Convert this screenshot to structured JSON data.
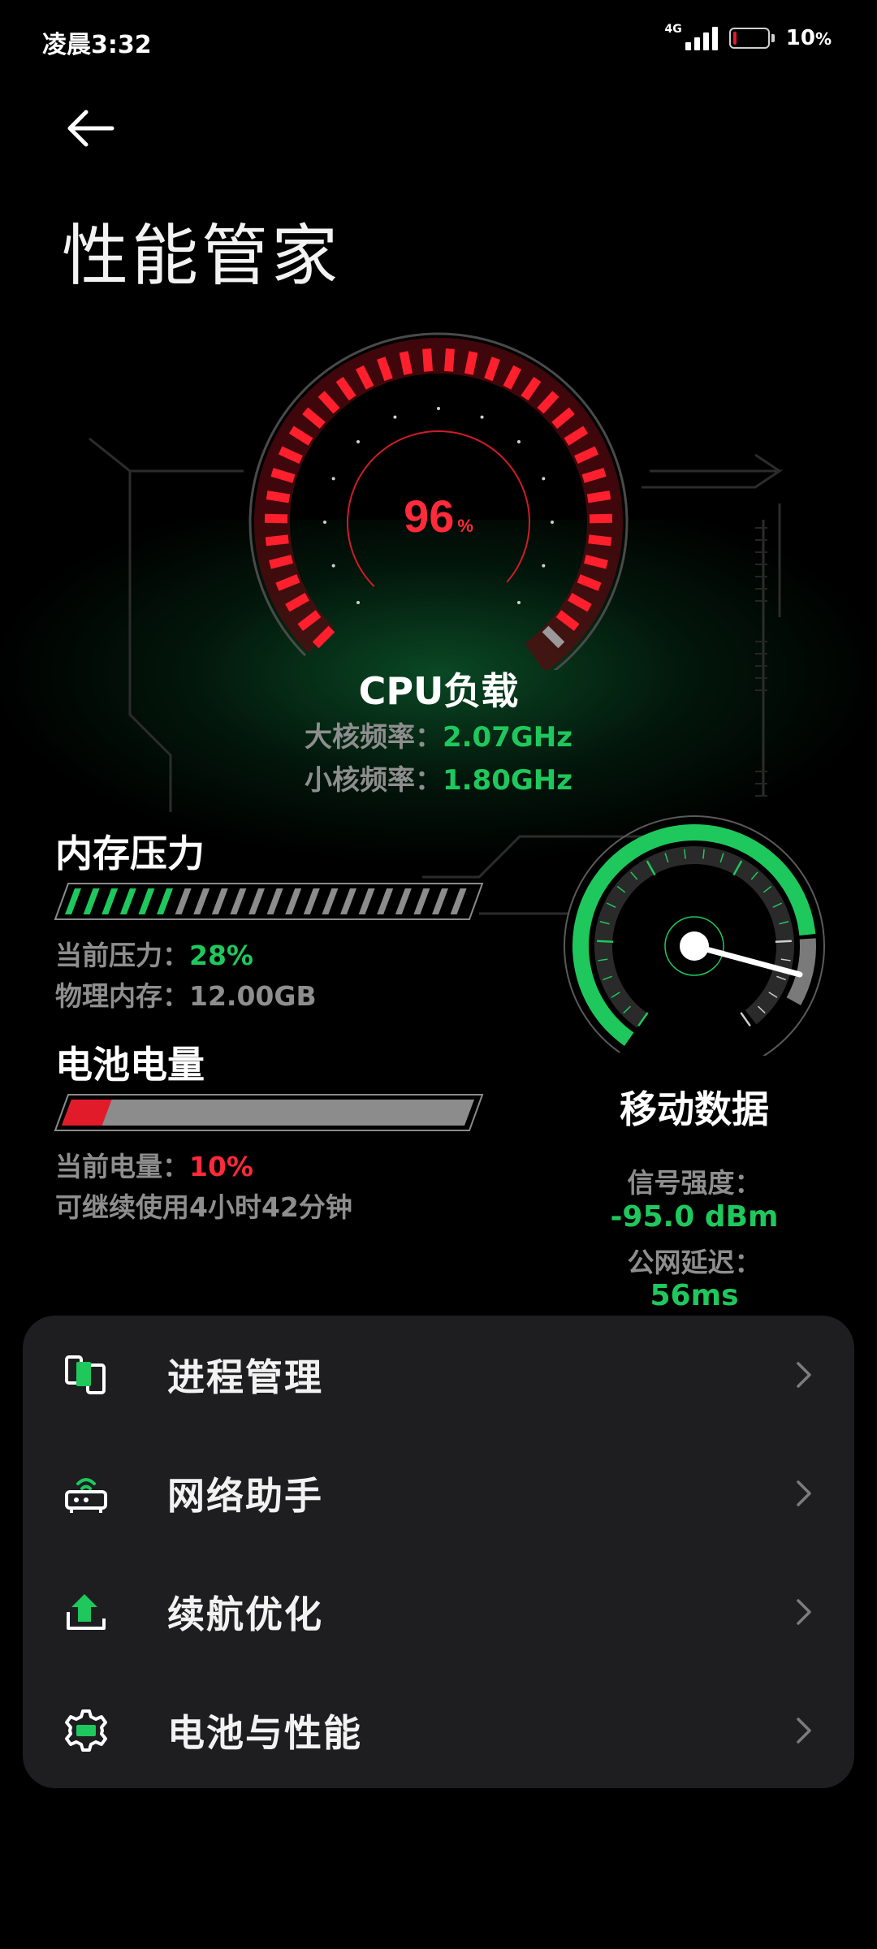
{
  "status_bar": {
    "time": "凌晨3:32",
    "network": "4G",
    "battery_percent": "10",
    "battery_unit": "%"
  },
  "header": {
    "back_icon": "arrow-left-icon",
    "title": "性能管家"
  },
  "cpu": {
    "load_value": "96",
    "load_unit": "%",
    "load_fraction": 0.96,
    "title": "CPU负载",
    "big_core_label": "大核频率：",
    "big_core_value": "2.07GHz",
    "little_core_label": "小核频率：",
    "little_core_value": "1.80GHz"
  },
  "memory": {
    "title": "内存压力",
    "pressure_label": "当前压力：",
    "pressure_value": "28%",
    "pressure_fraction": 0.28,
    "physical_label": "物理内存：",
    "physical_value": "12.00GB"
  },
  "battery": {
    "title": "电池电量",
    "level_label": "当前电量：",
    "level_value": "10%",
    "level_fraction": 0.1,
    "remaining": "可继续使用4小时42分钟"
  },
  "mobile_data": {
    "title": "移动数据",
    "signal_label": "信号强度：",
    "signal_value": "-95.0 dBm",
    "latency_label": "公网延迟：",
    "latency_value": "56ms"
  },
  "menu": {
    "items": [
      {
        "label": "进程管理",
        "icon": "process-icon"
      },
      {
        "label": "网络助手",
        "icon": "router-icon"
      },
      {
        "label": "续航优化",
        "icon": "battery-upload-icon"
      },
      {
        "label": "电池与性能",
        "icon": "gear-battery-icon"
      }
    ]
  },
  "colors": {
    "accent_green": "#1ec85d",
    "alert_red": "#ff2a3a",
    "card_bg": "#1e1e20",
    "label_gray": "#8e8e8e"
  }
}
